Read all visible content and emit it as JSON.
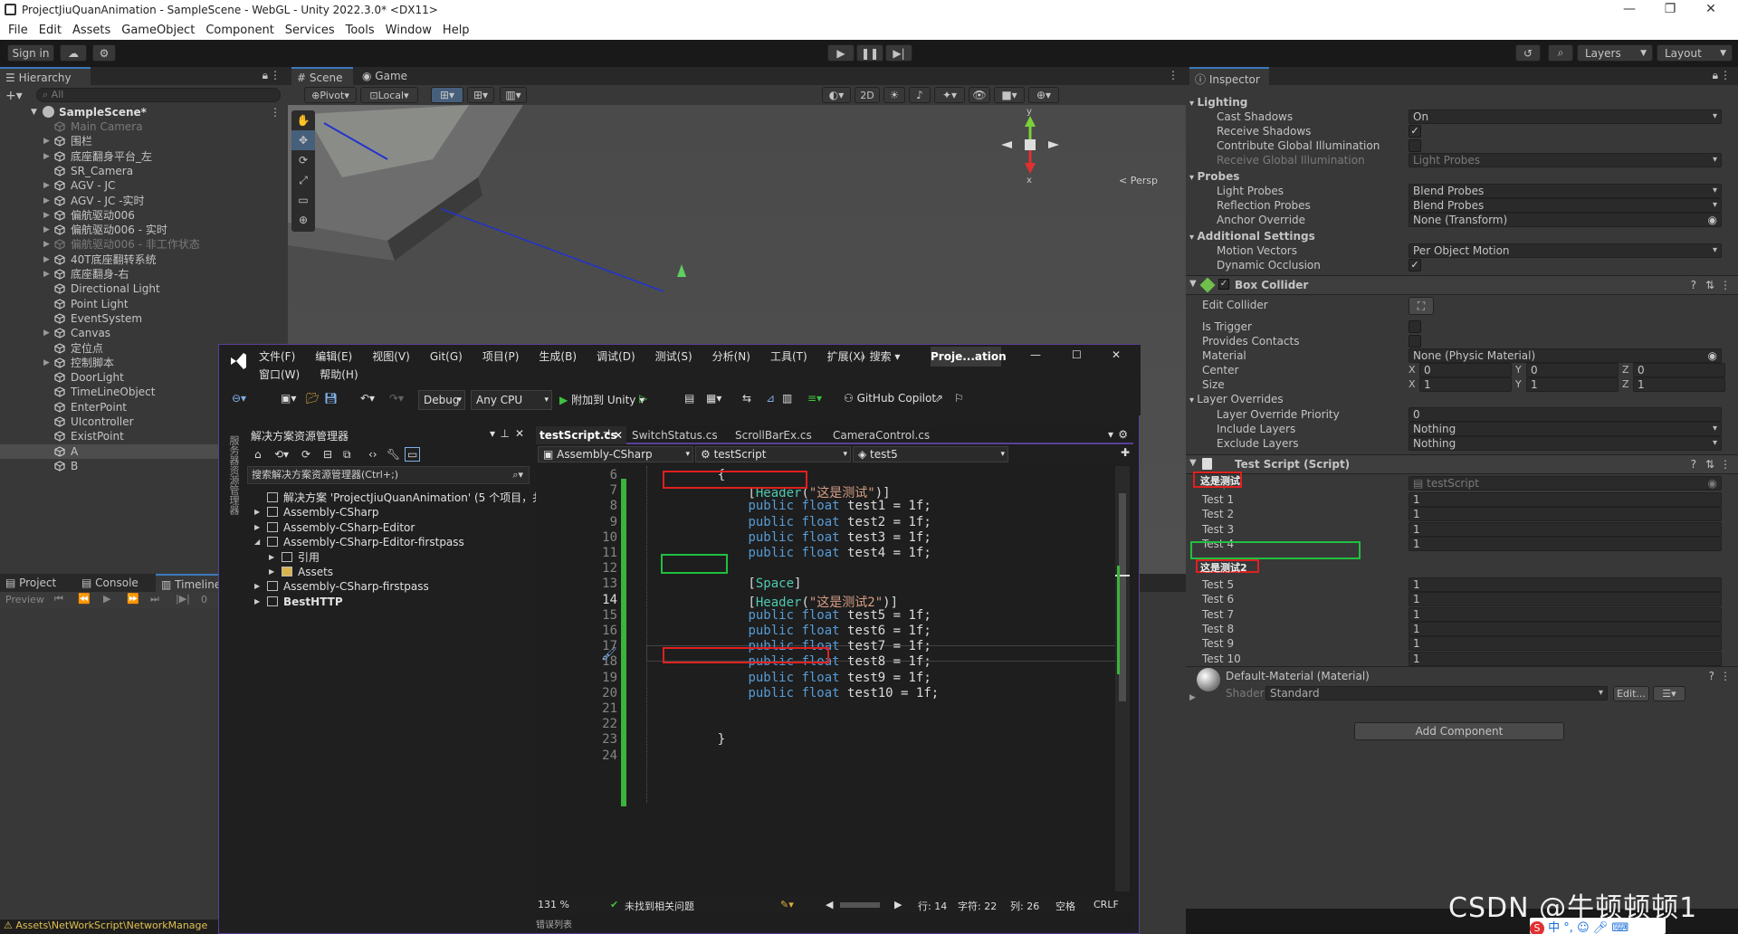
{
  "window": {
    "title": "ProjectJiuQuanAnimation - SampleScene - WebGL - Unity 2022.3.0* <DX11>"
  },
  "menu": [
    "File",
    "Edit",
    "Assets",
    "GameObject",
    "Component",
    "Services",
    "Tools",
    "Window",
    "Help"
  ],
  "toolbar": {
    "sign_in": "Sign in",
    "layers": "Layers",
    "layout": "Layout"
  },
  "hierarchy": {
    "tab": "Hierarchy",
    "search_placeholder": "All",
    "scene": "SampleScene*",
    "items": [
      {
        "label": "Main Camera",
        "disabled": true,
        "arrow": false
      },
      {
        "label": "围栏",
        "disabled": false,
        "arrow": true
      },
      {
        "label": "底座翻身平台_左",
        "disabled": false,
        "arrow": true
      },
      {
        "label": "SR_Camera",
        "disabled": false,
        "arrow": false
      },
      {
        "label": "AGV - JC",
        "disabled": false,
        "arrow": true
      },
      {
        "label": "AGV - JC -实时",
        "disabled": false,
        "arrow": true
      },
      {
        "label": "偏航驱动006",
        "disabled": false,
        "arrow": true
      },
      {
        "label": "偏航驱动006 - 实时",
        "disabled": false,
        "arrow": true
      },
      {
        "label": "偏航驱动006 - 非工作状态",
        "disabled": true,
        "arrow": true
      },
      {
        "label": "40T底座翻转系统",
        "disabled": false,
        "arrow": true
      },
      {
        "label": "底座翻身-右",
        "disabled": false,
        "arrow": true
      },
      {
        "label": "Directional Light",
        "disabled": false,
        "arrow": false
      },
      {
        "label": "Point Light",
        "disabled": false,
        "arrow": false
      },
      {
        "label": "EventSystem",
        "disabled": false,
        "arrow": false
      },
      {
        "label": "Canvas",
        "disabled": false,
        "arrow": true
      },
      {
        "label": "定位点",
        "disabled": false,
        "arrow": false
      },
      {
        "label": "控制脚本",
        "disabled": false,
        "arrow": true
      },
      {
        "label": "DoorLight",
        "disabled": false,
        "arrow": false
      },
      {
        "label": "TimeLineObject",
        "disabled": false,
        "arrow": false
      },
      {
        "label": "EnterPoint",
        "disabled": false,
        "arrow": false
      },
      {
        "label": "UIcontroller",
        "disabled": false,
        "arrow": false
      },
      {
        "label": "ExistPoint",
        "disabled": false,
        "arrow": false
      },
      {
        "label": "A",
        "disabled": false,
        "arrow": false,
        "selected": true
      },
      {
        "label": "B",
        "disabled": false,
        "arrow": false
      }
    ]
  },
  "scene_view": {
    "tab_scene": "Scene",
    "tab_game": "Game",
    "pivot": "Pivot",
    "local": "Local",
    "mode_2d": "2D",
    "persp": "< Persp",
    "axis_y": "y",
    "axis_x": "x"
  },
  "bottom": {
    "tab_project": "Project",
    "tab_console": "Console",
    "tab_timeline": "Timeline",
    "preview": "Preview",
    "frame": "0",
    "status": "Assets\\NetWorkScript\\NetworkManage"
  },
  "inspector": {
    "tab": "Inspector",
    "lighting": {
      "header": "Lighting",
      "cast_shadows": "Cast Shadows",
      "cast_shadows_val": "On",
      "receive_shadows": "Receive Shadows",
      "contribute_gi": "Contribute Global Illumination",
      "receive_gi": "Receive Global Illumination",
      "receive_gi_val": "Light Probes"
    },
    "probes": {
      "header": "Probes",
      "light_probes": "Light Probes",
      "light_probes_val": "Blend Probes",
      "reflection_probes": "Reflection Probes",
      "reflection_probes_val": "Blend Probes",
      "anchor_override": "Anchor Override",
      "anchor_override_val": "None (Transform)"
    },
    "additional": {
      "header": "Additional Settings",
      "motion_vectors": "Motion Vectors",
      "motion_vectors_val": "Per Object Motion",
      "dynamic_occlusion": "Dynamic Occlusion"
    },
    "box_collider": {
      "title": "Box Collider",
      "edit_collider": "Edit Collider",
      "is_trigger": "Is Trigger",
      "provides_contacts": "Provides Contacts",
      "material": "Material",
      "material_val": "None (Physic Material)",
      "center": "Center",
      "size": "Size",
      "center_vals": [
        "0",
        "0",
        "0"
      ],
      "size_vals": [
        "1",
        "1",
        "1"
      ],
      "axes": [
        "X",
        "Y",
        "Z"
      ],
      "layer_overrides": "Layer Overrides",
      "layer_priority": "Layer Override Priority",
      "layer_priority_val": "0",
      "include_layers": "Include Layers",
      "include_layers_val": "Nothing",
      "exclude_layers": "Exclude Layers",
      "exclude_layers_val": "Nothing"
    },
    "test_script": {
      "title": "Test Script (Script)",
      "script_label": "Script",
      "script_val": "testScript",
      "header1": "这是测试",
      "header2": "这是测试2",
      "fields1": [
        {
          "label": "Test 1",
          "value": "1"
        },
        {
          "label": "Test 2",
          "value": "1"
        },
        {
          "label": "Test 3",
          "value": "1"
        },
        {
          "label": "Test 4",
          "value": "1"
        }
      ],
      "fields2": [
        {
          "label": "Test 5",
          "value": "1"
        },
        {
          "label": "Test 6",
          "value": "1"
        },
        {
          "label": "Test 7",
          "value": "1"
        },
        {
          "label": "Test 8",
          "value": "1"
        },
        {
          "label": "Test 9",
          "value": "1"
        },
        {
          "label": "Test 10",
          "value": "1"
        }
      ]
    },
    "material": {
      "name": "Default-Material (Material)",
      "shader_label": "Shader",
      "shader_val": "Standard",
      "edit": "Edit..."
    },
    "add_component": "Add Component"
  },
  "vs": {
    "menu_row1": [
      "文件(F)",
      "编辑(E)",
      "视图(V)",
      "Git(G)",
      "项目(P)",
      "生成(B)",
      "调试(D)",
      "测试(S)",
      "分析(N)",
      "工具(T)",
      "扩展(X)"
    ],
    "menu_row2": [
      "窗口(W)",
      "帮助(H)"
    ],
    "search": "搜索",
    "project_title": "Proje...ation",
    "config": "Debug",
    "platform": "Any CPU",
    "attach": "附加到 Unity",
    "copilot": "GitHub Copilot",
    "side_label": "服务器资源管理器",
    "solution_explorer": {
      "title": "解决方案资源管理器",
      "search": "搜索解决方案资源管理器(Ctrl+;)",
      "items": [
        {
          "label": "解决方案 'ProjectJiuQuanAnimation' (5 个项目，共",
          "indent": 0,
          "arrow": ""
        },
        {
          "label": "Assembly-CSharp",
          "indent": 1,
          "arrow": "▶"
        },
        {
          "label": "Assembly-CSharp-Editor",
          "indent": 1,
          "arrow": "▶"
        },
        {
          "label": "Assembly-CSharp-Editor-firstpass",
          "indent": 1,
          "arrow": "◢"
        },
        {
          "label": "引用",
          "indent": 2,
          "arrow": "▶"
        },
        {
          "label": "Assets",
          "indent": 2,
          "arrow": "▶"
        },
        {
          "label": "Assembly-CSharp-firstpass",
          "indent": 1,
          "arrow": "▶"
        },
        {
          "label": "BestHTTP",
          "indent": 1,
          "arrow": "▶",
          "bold": true
        }
      ]
    },
    "tabs": [
      "testScript.cs",
      "SwitchStatus.cs",
      "ScrollBarEx.cs",
      "CameraControl.cs"
    ],
    "nav": {
      "assembly": "Assembly-CSharp",
      "class": "testScript",
      "member": "test5"
    },
    "code": [
      {
        "n": "6",
        "t": "    {"
      },
      {
        "n": "7",
        "t": "        [Header(\"这是测试\")]"
      },
      {
        "n": "8",
        "t": "        public float test1 = 1f;"
      },
      {
        "n": "9",
        "t": "        public float test2 = 1f;"
      },
      {
        "n": "10",
        "t": "        public float test3 = 1f;"
      },
      {
        "n": "11",
        "t": "        public float test4 = 1f;"
      },
      {
        "n": "12",
        "t": ""
      },
      {
        "n": "13",
        "t": "        [Space]"
      },
      {
        "n": "14",
        "t": "        [Header(\"这是测试2\")]"
      },
      {
        "n": "15",
        "t": "        public float test5 = 1f;"
      },
      {
        "n": "16",
        "t": "        public float test6 = 1f;"
      },
      {
        "n": "17",
        "t": "        public float test7 = 1f;"
      },
      {
        "n": "18",
        "t": "        public float test8 = 1f;"
      },
      {
        "n": "19",
        "t": "        public float test9 = 1f;"
      },
      {
        "n": "20",
        "t": "        public float test10 = 1f;"
      },
      {
        "n": "21",
        "t": ""
      },
      {
        "n": "22",
        "t": ""
      },
      {
        "n": "23",
        "t": "    }"
      },
      {
        "n": "24",
        "t": ""
      }
    ],
    "status": {
      "zoom": "131 %",
      "issues": "未找到相关问题",
      "line": "行: 14",
      "char": "字符: 22",
      "col": "列: 26",
      "space": "空格",
      "eol": "CRLF",
      "bottom_tab": "错误列表"
    }
  },
  "watermark": "CSDN @牛顿顿顿1",
  "ime": "中"
}
